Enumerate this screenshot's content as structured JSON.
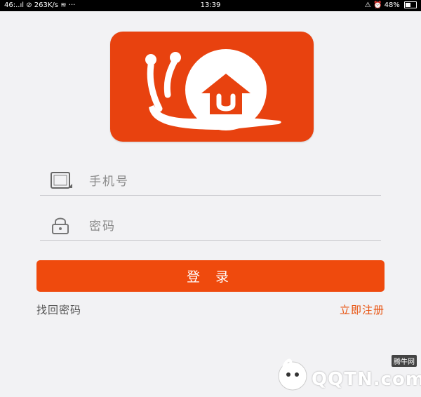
{
  "status_bar": {
    "signal": "46:..ıl",
    "speed": "263K/s",
    "more": "···",
    "time": "13:39",
    "battery": "48%"
  },
  "colors": {
    "brand": "#e8420f",
    "button": "#ef4a0d",
    "link_accent": "#e8530f"
  },
  "login_form": {
    "phone_placeholder": "手机号",
    "phone_icon": "phone-icon",
    "password_placeholder": "密码",
    "password_icon": "lock-icon",
    "login_label": "登 录",
    "forgot_label": "找回密码",
    "register_label": "立即注册"
  },
  "watermark": {
    "text": "QQTN.com",
    "badge": "腾牛网"
  }
}
